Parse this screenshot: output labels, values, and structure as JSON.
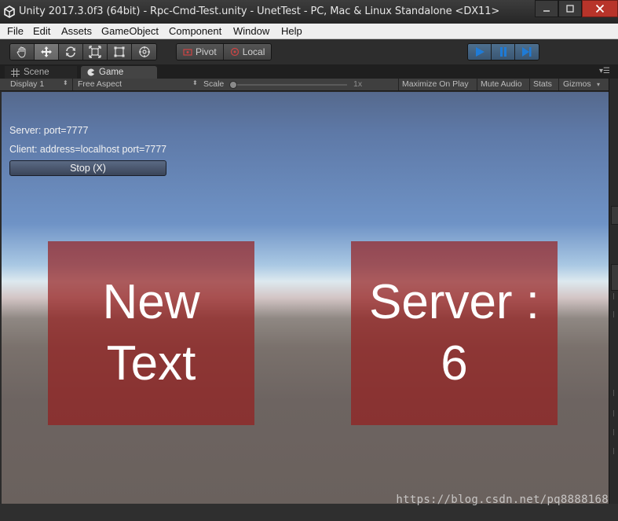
{
  "window": {
    "title": "Unity 2017.3.0f3 (64bit) - Rpc-Cmd-Test.unity - UnetTest - PC, Mac & Linux Standalone <DX11>",
    "logo_icon": "unity-logo-icon",
    "controls": [
      "minimize-icon",
      "maximize-icon",
      "close-icon"
    ]
  },
  "menubar": {
    "items": [
      {
        "label": "File"
      },
      {
        "label": "Edit"
      },
      {
        "label": "Assets"
      },
      {
        "label": "GameObject"
      },
      {
        "label": "Component"
      },
      {
        "label": "Window"
      },
      {
        "label": "Help"
      }
    ]
  },
  "toolbar": {
    "transform_tools": [
      "hand-tool-icon",
      "move-tool-icon",
      "rotate-tool-icon",
      "scale-tool-icon",
      "rect-tool-icon",
      "transform-tool-icon"
    ],
    "active_tool": "move-tool-icon",
    "pivot_label": "Pivot",
    "space_label": "Local",
    "play_controls": [
      "play-icon",
      "pause-icon",
      "step-icon"
    ],
    "accent_color": "#1f7bd6"
  },
  "tabs": {
    "scene_label": "Scene",
    "game_label": "Game",
    "active": "Game"
  },
  "gamebar": {
    "display_label": "Display 1",
    "aspect_label": "Free Aspect",
    "scale_label": "Scale",
    "scale_value": "1x",
    "maximize_label": "Maximize On Play",
    "mute_label": "Mute Audio",
    "stats_label": "Stats",
    "gizmos_label": "Gizmos"
  },
  "game": {
    "server_line": "Server: port=7777",
    "client_line": "Client: address=localhost port=7777",
    "stop_button_label": "Stop (X)",
    "left_panel": {
      "line1": "New",
      "line2": "Text"
    },
    "right_panel": {
      "line1": "Server :",
      "line2": "6"
    },
    "panel_color": "#961e1e"
  },
  "watermark": "https://blog.csdn.net/pq8888168"
}
